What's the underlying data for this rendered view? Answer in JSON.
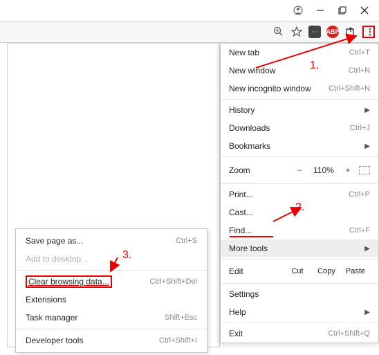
{
  "window": {
    "profile": "●"
  },
  "toolbar": {
    "abp": "ABP"
  },
  "menu": {
    "new_tab": "New tab",
    "new_tab_sc": "Ctrl+T",
    "new_window": "New window",
    "new_window_sc": "Ctrl+N",
    "new_incognito": "New incognito window",
    "new_incognito_sc": "Ctrl+Shift+N",
    "history": "History",
    "downloads": "Downloads",
    "downloads_sc": "Ctrl+J",
    "bookmarks": "Bookmarks",
    "zoom": "Zoom",
    "zoom_minus": "−",
    "zoom_val": "110%",
    "zoom_plus": "+",
    "print": "Print...",
    "print_sc": "Ctrl+P",
    "cast": "Cast...",
    "find": "Find...",
    "find_sc": "Ctrl+F",
    "more_tools": "More tools",
    "edit": "Edit",
    "cut": "Cut",
    "copy": "Copy",
    "paste": "Paste",
    "settings": "Settings",
    "help": "Help",
    "exit": "Exit",
    "exit_sc": "Ctrl+Shift+Q"
  },
  "submenu": {
    "save_page": "Save page as...",
    "save_page_sc": "Ctrl+S",
    "add_desktop": "Add to desktop...",
    "clear_data": "Clear browsing data...",
    "clear_data_sc": "Ctrl+Shift+Del",
    "extensions": "Extensions",
    "task_manager": "Task manager",
    "task_manager_sc": "Shift+Esc",
    "dev_tools": "Developer tools",
    "dev_tools_sc": "Ctrl+Shift+I"
  },
  "annotations": {
    "a1": "1.",
    "a2": "2.",
    "a3": "3."
  }
}
